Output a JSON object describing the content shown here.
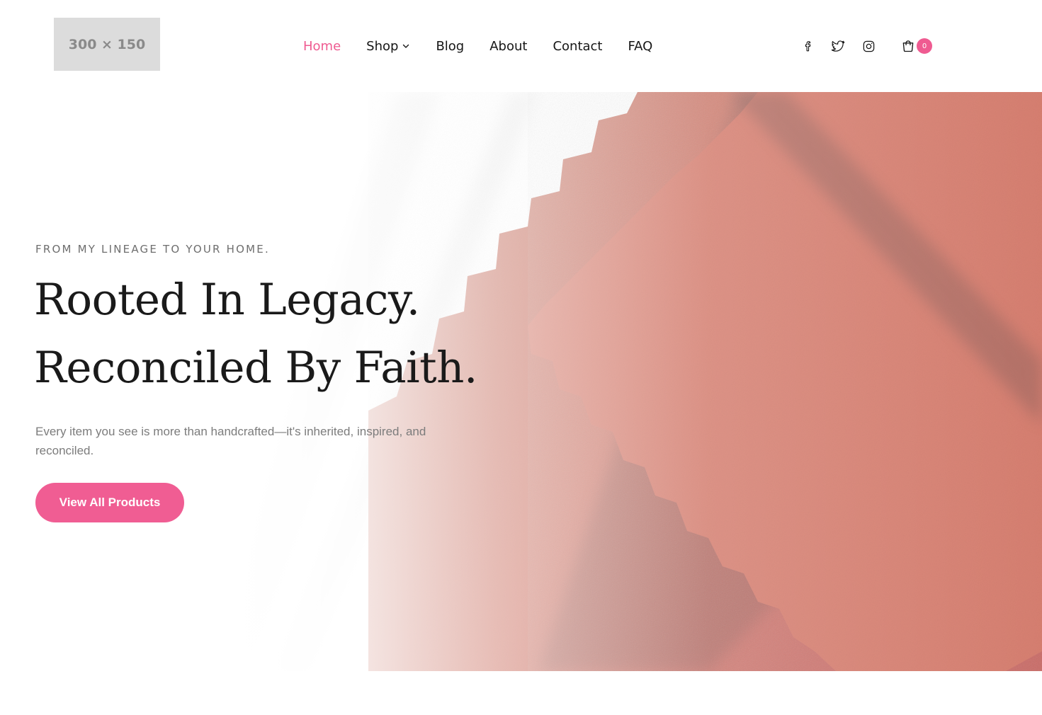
{
  "header": {
    "logo_text": "300 × 150",
    "nav": [
      {
        "label": "Home",
        "active": true
      },
      {
        "label": "Shop",
        "has_dropdown": true
      },
      {
        "label": "Blog"
      },
      {
        "label": "About"
      },
      {
        "label": "Contact"
      },
      {
        "label": "FAQ"
      }
    ],
    "social_icons": [
      "facebook-icon",
      "twitter-icon",
      "instagram-icon"
    ],
    "cart": {
      "icon": "cart-icon",
      "count": "0"
    }
  },
  "hero": {
    "eyebrow": "FROM MY LINEAGE TO YOUR HOME.",
    "headline_line1": "Rooted In Legacy.",
    "headline_line2": "Reconciled By Faith.",
    "subtext": "Every item you see is more than handcrafted—it's inherited, inspired, and reconciled.",
    "cta_label": "View All Products"
  },
  "colors": {
    "accent": "#ef5b91",
    "text": "#1a1a1a",
    "muted": "#7c7c7c",
    "fabric": "#c96a55"
  }
}
